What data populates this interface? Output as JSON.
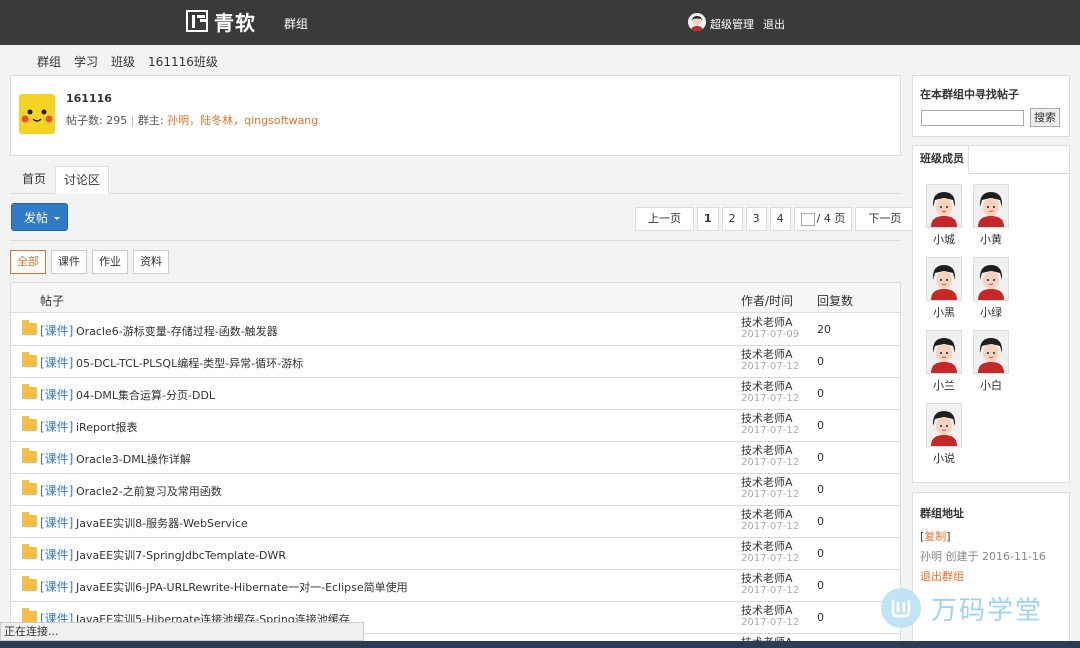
{
  "header": {
    "logo_text": "青软",
    "nav_group": "群组",
    "user_name": "超级管理",
    "logout": "退出"
  },
  "breadcrumb": [
    "群组",
    "学习",
    "班级",
    "161116班级"
  ],
  "group": {
    "name": "161116",
    "post_count_label": "帖子数: 295",
    "owner_label": "群主:",
    "owners": "孙明，陆冬林，qingsoftwang"
  },
  "tabs": [
    "首页",
    "讨论区"
  ],
  "post_button": "发帖",
  "pager": {
    "prev": "上一页",
    "pages": [
      "1",
      "2",
      "3",
      "4"
    ],
    "total": "/ 4 页",
    "next": "下一页"
  },
  "filters": [
    "全部",
    "课件",
    "作业",
    "资料"
  ],
  "table": {
    "headers": {
      "post": "帖子",
      "author": "作者/时间",
      "replies": "回复数"
    },
    "rows": [
      {
        "category": "[课件]",
        "title": "Oracle6-游标变量-存储过程-函数-触发器",
        "author": "技术老师A",
        "date": "2017-07-09",
        "replies": "20"
      },
      {
        "category": "[课件]",
        "title": "05-DCL-TCL-PLSQL编程-类型-异常-循环-游标",
        "author": "技术老师A",
        "date": "2017-07-12",
        "replies": "0"
      },
      {
        "category": "[课件]",
        "title": "04-DML集合运算-分页-DDL",
        "author": "技术老师A",
        "date": "2017-07-12",
        "replies": "0"
      },
      {
        "category": "[课件]",
        "title": "iReport报表",
        "author": "技术老师A",
        "date": "2017-07-12",
        "replies": "0"
      },
      {
        "category": "[课件]",
        "title": "Oracle3-DML操作详解",
        "author": "技术老师A",
        "date": "2017-07-12",
        "replies": "0"
      },
      {
        "category": "[课件]",
        "title": "Oracle2-之前复习及常用函数",
        "author": "技术老师A",
        "date": "2017-07-12",
        "replies": "0"
      },
      {
        "category": "[课件]",
        "title": "JavaEE实训8-服务器-WebService",
        "author": "技术老师A",
        "date": "2017-07-12",
        "replies": "0"
      },
      {
        "category": "[课件]",
        "title": "JavaEE实训7-SpringJdbcTemplate-DWR",
        "author": "技术老师A",
        "date": "2017-07-12",
        "replies": "0"
      },
      {
        "category": "[课件]",
        "title": "JavaEE实训6-JPA-URLRewrite-Hibernate一对一-Eclipse简单使用",
        "author": "技术老师A",
        "date": "2017-07-12",
        "replies": "0"
      },
      {
        "category": "[课件]",
        "title": "JavaEE实训5-Hibernate连接池缓存-Spring连接池缓存",
        "author": "技术老师A",
        "date": "2017-07-12",
        "replies": "0"
      },
      {
        "category": "",
        "title": "",
        "author": "技术老师A",
        "date": "",
        "replies": ""
      }
    ]
  },
  "search": {
    "title": "在本群组中寻找帖子",
    "button": "搜索",
    "value": ""
  },
  "members": {
    "title": "班级成员",
    "list": [
      "小城",
      "小黄",
      "小黑",
      "小绿",
      "小兰",
      "小白",
      "小说"
    ]
  },
  "address": {
    "title": "群组地址",
    "copy_open": "[",
    "copy": "复制",
    "copy_close": "]",
    "created": "孙明 创建于 2016-11-16",
    "exit": "退出群组"
  },
  "watermark": {
    "text": "万码学堂"
  },
  "status_bar": "正在连接..."
}
